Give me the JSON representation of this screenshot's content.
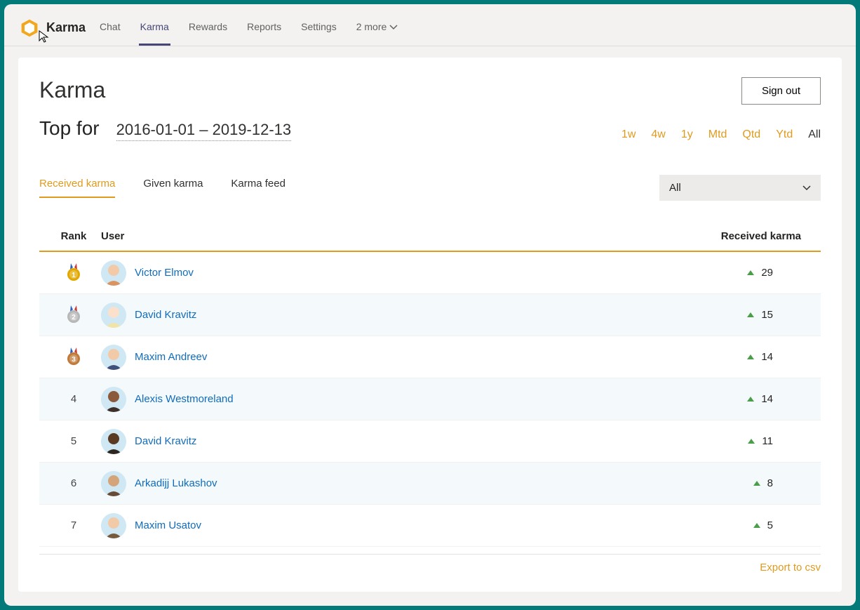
{
  "app": {
    "name": "Karma"
  },
  "topnav": {
    "tabs": [
      {
        "label": "Chat",
        "active": false
      },
      {
        "label": "Karma",
        "active": true
      },
      {
        "label": "Rewards",
        "active": false
      },
      {
        "label": "Reports",
        "active": false
      },
      {
        "label": "Settings",
        "active": false
      }
    ],
    "more_label": "2 more"
  },
  "page": {
    "title": "Karma",
    "signout_label": "Sign out",
    "top_for_label": "Top for",
    "date_range": "2016-01-01 – 2019-12-13",
    "ranges": [
      {
        "label": "1w",
        "selected": false
      },
      {
        "label": "4w",
        "selected": false
      },
      {
        "label": "1y",
        "selected": false
      },
      {
        "label": "Mtd",
        "selected": false
      },
      {
        "label": "Qtd",
        "selected": false
      },
      {
        "label": "Ytd",
        "selected": false
      },
      {
        "label": "All",
        "selected": true
      }
    ],
    "subtabs": [
      {
        "label": "Received karma",
        "active": true
      },
      {
        "label": "Given karma",
        "active": false
      },
      {
        "label": "Karma feed",
        "active": false
      }
    ],
    "channel_filter": "All",
    "export_label": "Export to csv"
  },
  "table": {
    "cols": {
      "rank": "Rank",
      "user": "User",
      "karma": "Received karma"
    },
    "rows": [
      {
        "rank": 1,
        "medal": "gold",
        "user": "Victor Elmov",
        "karma": 29,
        "avatar_bg": "#cfe8f4",
        "avatar_face": "#f2caa7",
        "avatar_hair": "#d98b52"
      },
      {
        "rank": 2,
        "medal": "silver",
        "user": "David Kravitz",
        "karma": 15,
        "avatar_bg": "#cfe8f4",
        "avatar_face": "#fbe0cc",
        "avatar_hair": "#f4e3a1"
      },
      {
        "rank": 3,
        "medal": "bronze",
        "user": "Maxim Andreev",
        "karma": 14,
        "avatar_bg": "#cfe8f4",
        "avatar_face": "#f2caa7",
        "avatar_hair": "#2d3e6d"
      },
      {
        "rank": 4,
        "medal": null,
        "user": "Alexis Westmoreland",
        "karma": 14,
        "avatar_bg": "#cfe8f4",
        "avatar_face": "#8a5a3a",
        "avatar_hair": "#2b1a12"
      },
      {
        "rank": 5,
        "medal": null,
        "user": "David Kravitz",
        "karma": 11,
        "avatar_bg": "#cfe8f4",
        "avatar_face": "#5a3a22",
        "avatar_hair": "#1a1108"
      },
      {
        "rank": 6,
        "medal": null,
        "user": "Arkadijj Lukashov",
        "karma": 8,
        "avatar_bg": "#cfe8f4",
        "avatar_face": "#d4a57a",
        "avatar_hair": "#5a3a22"
      },
      {
        "rank": 7,
        "medal": null,
        "user": "Maxim Usatov",
        "karma": 5,
        "avatar_bg": "#cfe8f4",
        "avatar_face": "#f2caa7",
        "avatar_hair": "#6b4a2a"
      }
    ]
  }
}
